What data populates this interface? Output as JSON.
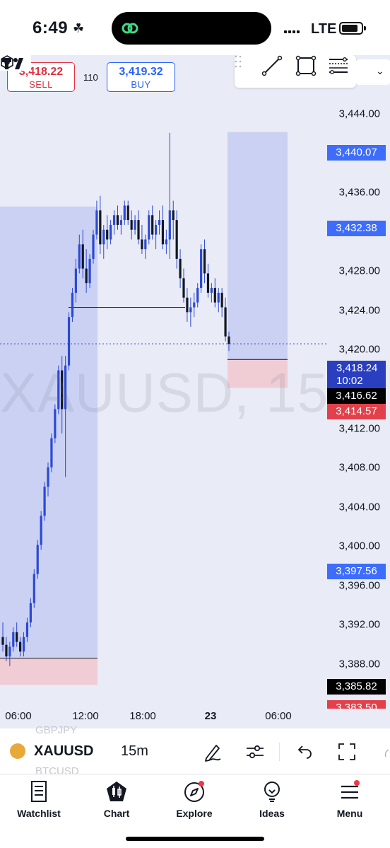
{
  "status_bar": {
    "time": "6:49",
    "network": "LTE"
  },
  "trade": {
    "sell_price": "3,418.22",
    "sell_label": "SELL",
    "spread": "110",
    "buy_price": "3,419.32",
    "buy_label": "BUY"
  },
  "chart": {
    "watermark": "XAUUSD, 15",
    "price_axis": [
      "3,444.00",
      "3,436.00",
      "3,428.00",
      "3,424.00",
      "3,420.00",
      "3,412.00",
      "3,408.00",
      "3,404.00",
      "3,400.00",
      "3,396.00",
      "3,392.00",
      "3,388.00"
    ],
    "tags": {
      "blue1": "3,440.07",
      "blue2": "3,432.38",
      "current_price": "3,418.24",
      "countdown": "10:02",
      "black1": "3,416.62",
      "red1": "3,414.57",
      "blue3": "3,397.56",
      "black2": "3,385.82",
      "red2": "3,383.50"
    },
    "time_axis": [
      "06:00",
      "12:00",
      "18:00",
      "23",
      "06:00"
    ]
  },
  "chart_data": {
    "type": "candlestick",
    "symbol": "XAUUSD",
    "interval": "15m",
    "ylim": [
      3382,
      3448
    ],
    "x_ticks": [
      "06:00",
      "12:00",
      "18:00",
      "23",
      "06:00"
    ],
    "current_price": 3418.24,
    "candles": [
      [
        3388.0,
        3389.5,
        3386.5,
        3387.2
      ],
      [
        3387.2,
        3388.0,
        3385.5,
        3386.0
      ],
      [
        3386.0,
        3387.5,
        3385.0,
        3387.0
      ],
      [
        3387.0,
        3389.0,
        3386.5,
        3388.5
      ],
      [
        3388.5,
        3389.5,
        3387.0,
        3387.5
      ],
      [
        3387.5,
        3388.0,
        3386.0,
        3386.5
      ],
      [
        3386.5,
        3388.5,
        3386.0,
        3388.0
      ],
      [
        3388.0,
        3390.0,
        3387.5,
        3389.5
      ],
      [
        3389.5,
        3392.0,
        3389.0,
        3391.5
      ],
      [
        3391.5,
        3395.0,
        3391.0,
        3394.5
      ],
      [
        3394.5,
        3398.0,
        3394.0,
        3397.5
      ],
      [
        3397.5,
        3401.0,
        3397.0,
        3400.5
      ],
      [
        3400.5,
        3404.0,
        3400.0,
        3403.5
      ],
      [
        3403.5,
        3406.0,
        3402.5,
        3405.5
      ],
      [
        3405.5,
        3409.0,
        3405.0,
        3408.5
      ],
      [
        3408.5,
        3412.0,
        3408.0,
        3411.5
      ],
      [
        3411.5,
        3416.0,
        3411.0,
        3415.5
      ],
      [
        3415.5,
        3417.0,
        3409.0,
        3411.5
      ],
      [
        3411.5,
        3417.0,
        3404.5,
        3416.0
      ],
      [
        3416.0,
        3421.5,
        3415.5,
        3421.0
      ],
      [
        3421.0,
        3424.0,
        3420.5,
        3423.5
      ],
      [
        3423.5,
        3427.0,
        3422.5,
        3426.0
      ],
      [
        3426.0,
        3429.5,
        3425.5,
        3428.5
      ],
      [
        3428.5,
        3430.0,
        3425.0,
        3426.0
      ],
      [
        3426.0,
        3428.0,
        3423.5,
        3424.5
      ],
      [
        3424.5,
        3427.5,
        3424.0,
        3427.0
      ],
      [
        3427.0,
        3430.0,
        3426.5,
        3429.5
      ],
      [
        3429.5,
        3433.0,
        3429.0,
        3432.0
      ],
      [
        3432.0,
        3433.5,
        3427.5,
        3428.5
      ],
      [
        3428.5,
        3430.5,
        3427.0,
        3430.0
      ],
      [
        3430.0,
        3431.5,
        3428.0,
        3429.0
      ],
      [
        3429.0,
        3431.0,
        3428.5,
        3430.5
      ],
      [
        3430.5,
        3432.0,
        3429.5,
        3431.5
      ],
      [
        3431.5,
        3432.5,
        3430.0,
        3430.5
      ],
      [
        3430.5,
        3431.5,
        3429.5,
        3431.0
      ],
      [
        3431.0,
        3433.0,
        3430.5,
        3432.5
      ],
      [
        3432.5,
        3433.0,
        3430.5,
        3431.0
      ],
      [
        3431.0,
        3432.0,
        3429.0,
        3430.0
      ],
      [
        3430.0,
        3431.5,
        3429.5,
        3431.0
      ],
      [
        3431.0,
        3432.0,
        3428.5,
        3429.0
      ],
      [
        3429.0,
        3430.5,
        3427.5,
        3428.0
      ],
      [
        3428.0,
        3429.5,
        3427.0,
        3429.0
      ],
      [
        3429.0,
        3432.0,
        3428.5,
        3431.5
      ],
      [
        3431.5,
        3432.5,
        3429.0,
        3429.5
      ],
      [
        3429.5,
        3431.0,
        3428.0,
        3430.5
      ],
      [
        3430.5,
        3432.0,
        3429.5,
        3431.0
      ],
      [
        3431.0,
        3432.5,
        3428.0,
        3428.5
      ],
      [
        3428.5,
        3430.0,
        3427.5,
        3429.0
      ],
      [
        3429.0,
        3440.0,
        3427.0,
        3432.0
      ],
      [
        3432.0,
        3433.0,
        3429.0,
        3431.0
      ],
      [
        3431.0,
        3432.0,
        3426.0,
        3427.0
      ],
      [
        3427.0,
        3428.0,
        3424.0,
        3425.0
      ],
      [
        3425.0,
        3426.0,
        3422.5,
        3423.0
      ],
      [
        3423.0,
        3424.0,
        3420.5,
        3421.5
      ],
      [
        3421.5,
        3423.0,
        3420.0,
        3422.0
      ],
      [
        3422.0,
        3423.5,
        3421.0,
        3422.5
      ],
      [
        3422.5,
        3424.5,
        3422.0,
        3424.0
      ],
      [
        3424.0,
        3428.5,
        3423.5,
        3428.0
      ],
      [
        3428.0,
        3429.0,
        3424.5,
        3425.5
      ],
      [
        3425.5,
        3426.5,
        3423.0,
        3423.5
      ],
      [
        3423.5,
        3424.5,
        3422.5,
        3424.0
      ],
      [
        3424.0,
        3425.0,
        3422.0,
        3422.5
      ],
      [
        3422.5,
        3424.0,
        3421.5,
        3423.5
      ],
      [
        3423.5,
        3424.0,
        3421.0,
        3422.0
      ],
      [
        3422.0,
        3423.0,
        3418.5,
        3419.0
      ],
      [
        3419.0,
        3419.5,
        3417.5,
        3418.24
      ]
    ],
    "levels": [
      {
        "label": "3,440.07",
        "value": 3440.07
      },
      {
        "label": "3,432.38",
        "value": 3432.38
      },
      {
        "label": "3,416.62",
        "value": 3416.62
      },
      {
        "label": "3,414.57",
        "value": 3414.57
      },
      {
        "label": "3,397.56",
        "value": 3397.56
      },
      {
        "label": "3,385.82",
        "value": 3385.82
      },
      {
        "label": "3,383.50",
        "value": 3383.5
      }
    ]
  },
  "symbol_bar": {
    "symbol": "XAUUSD",
    "interval": "15m",
    "ghost_above": "GBPJPY",
    "ghost_below": "BTCUSD"
  },
  "nav": {
    "watchlist": "Watchlist",
    "chart": "Chart",
    "explore": "Explore",
    "ideas": "Ideas",
    "menu": "Menu"
  },
  "colors": {
    "accent": "#2962ff",
    "sell": "#e2303e",
    "chart_bg": "#e9ebf6",
    "long_zone": "#c5cdf2",
    "short_zone": "#f0ccd4",
    "candle": "#2b49d6"
  }
}
